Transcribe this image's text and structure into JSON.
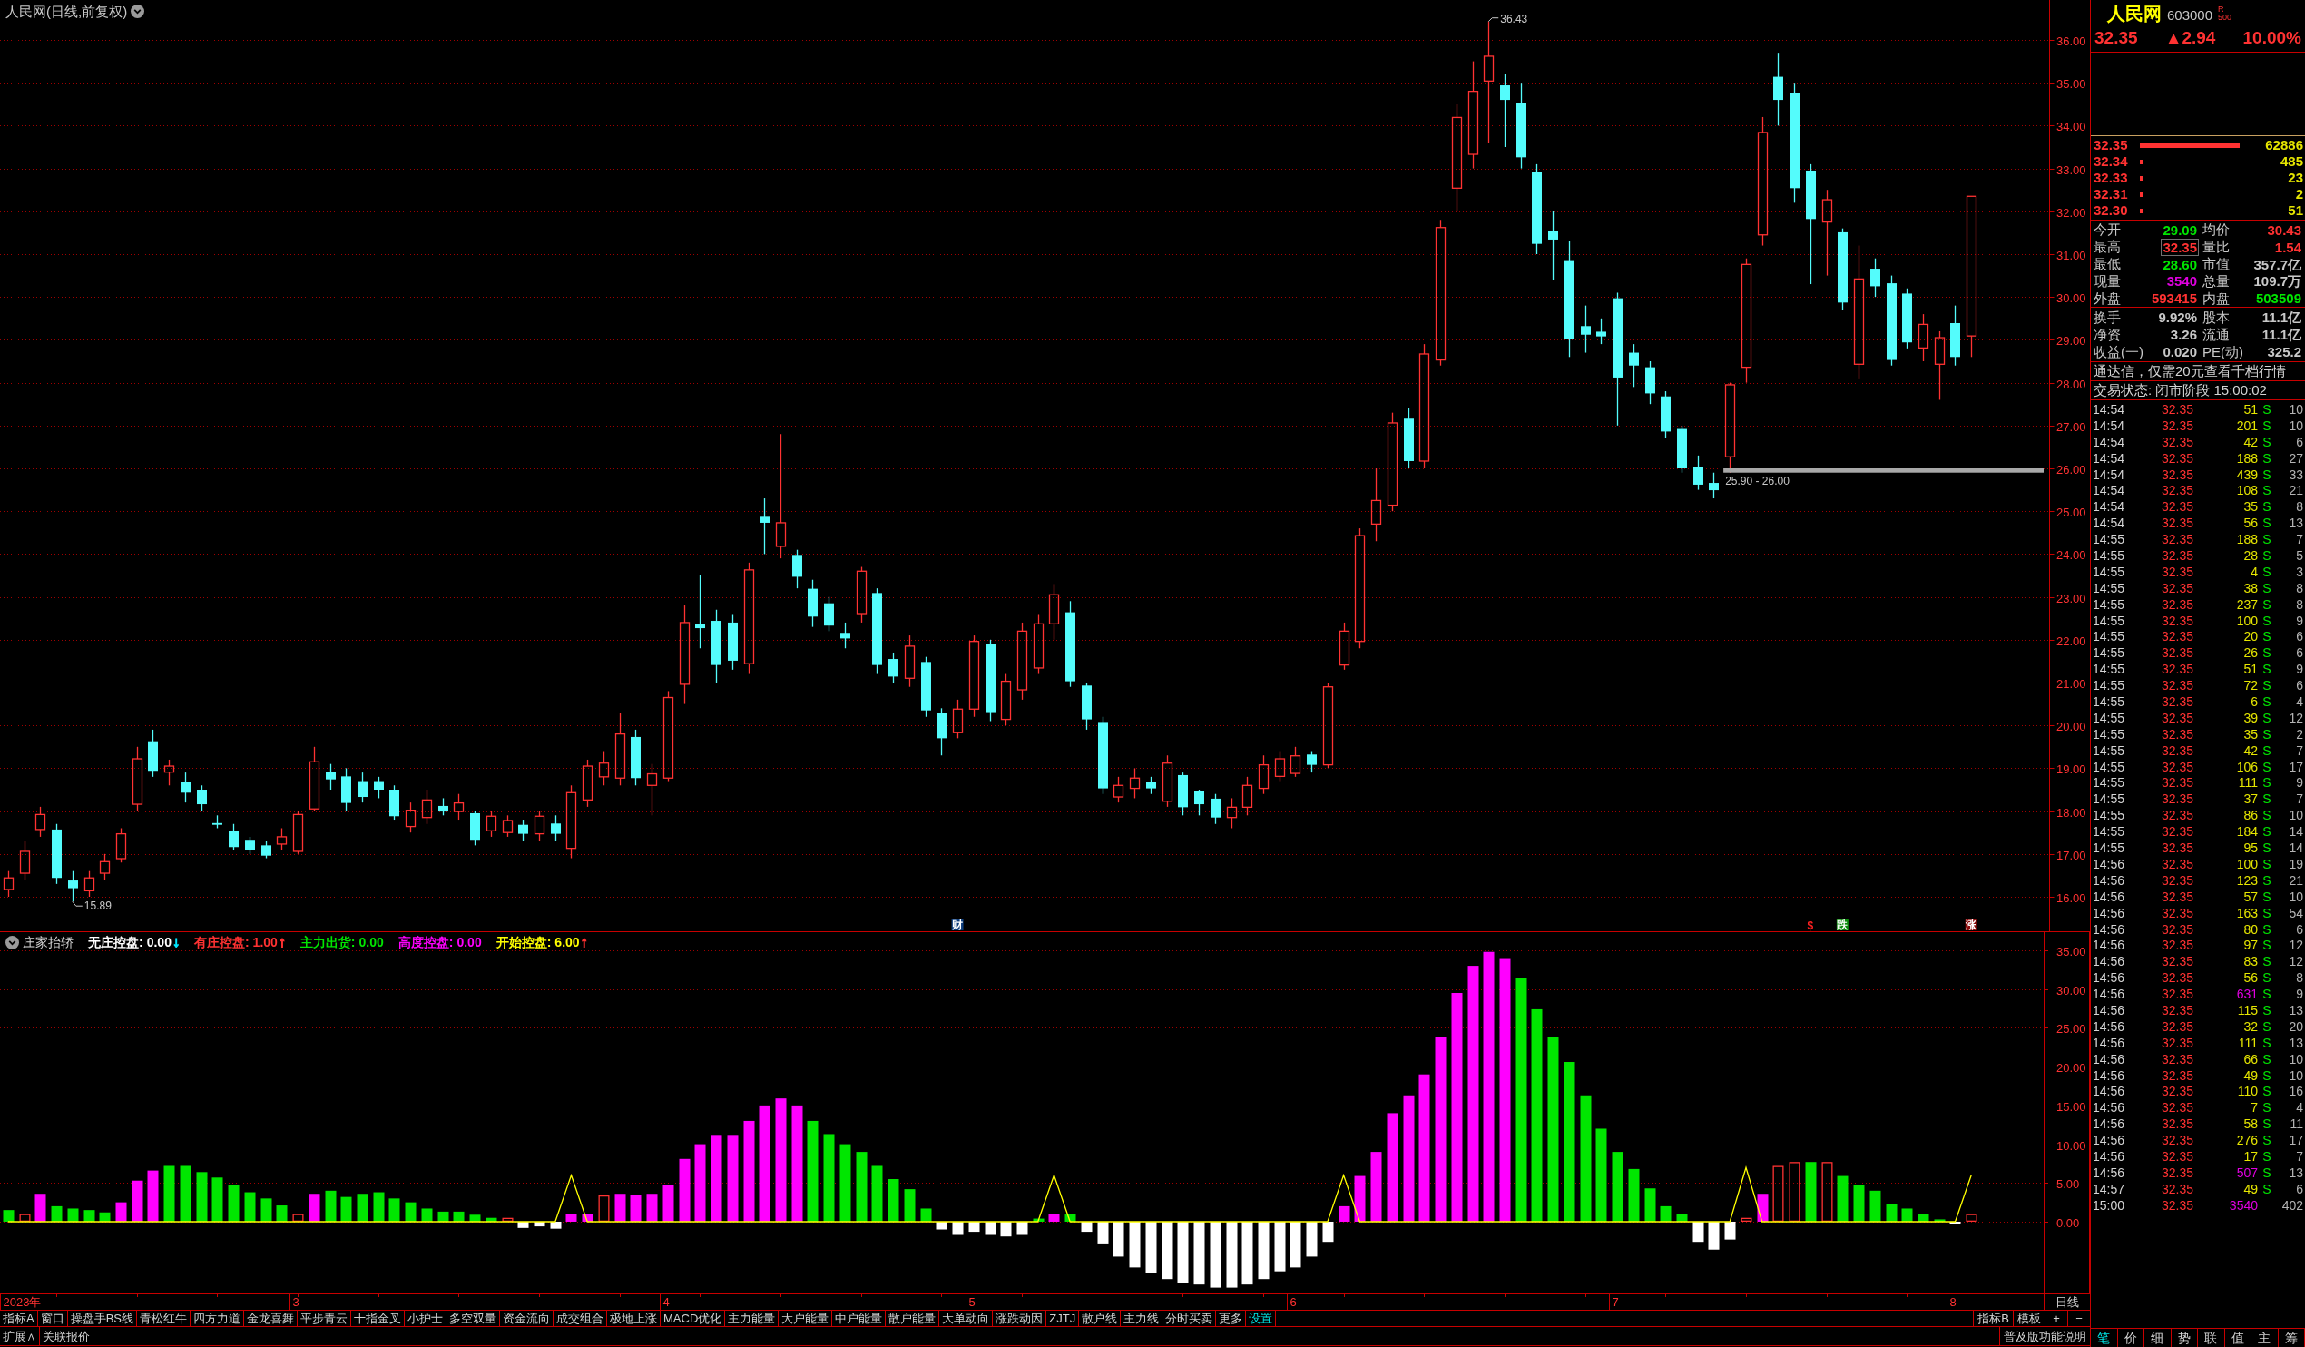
{
  "title": {
    "text": "人民网(日线,前复权)"
  },
  "main_chart": {
    "price_axis": [
      "36.00",
      "35.00",
      "34.00",
      "33.00",
      "32.00",
      "31.00",
      "30.00",
      "29.00",
      "28.00",
      "27.00",
      "26.00",
      "25.00",
      "24.00",
      "23.00",
      "22.00",
      "21.00",
      "20.00",
      "19.00",
      "18.00",
      "17.00",
      "16.00"
    ],
    "labels": {
      "peak": "36.43",
      "trough": "15.89",
      "range": "25.90 - 26.00"
    },
    "markers": [
      {
        "text": "财",
        "color": "#0c3c7c",
        "kind": "badge"
      },
      {
        "text": "$",
        "color": "#ff2020",
        "kind": "glyph"
      },
      {
        "text": "跌",
        "color": "#0a8a0a",
        "kind": "badge"
      },
      {
        "text": "涨",
        "color": "#8c0a0a",
        "kind": "badge"
      }
    ]
  },
  "indicator": {
    "name": "庄家抬轿",
    "chart_data": {
      "type": "bar",
      "grid": true,
      "stacked": true,
      "ylim": [
        -9.25,
        37.46
      ],
      "categories": [
        null,
        null,
        null,
        null,
        null,
        null,
        null,
        null,
        null,
        null,
        null,
        null,
        null,
        null,
        null,
        null,
        null,
        null,
        null,
        null,
        null,
        null,
        null,
        null,
        null,
        null,
        null,
        null,
        null,
        null,
        null,
        null,
        null,
        null,
        null,
        null,
        null,
        null,
        null,
        null,
        null,
        null,
        null,
        null,
        null,
        null,
        null,
        null,
        null,
        null,
        null,
        null,
        null,
        null,
        null,
        null,
        null,
        null,
        null,
        null,
        null,
        null,
        null,
        null,
        null,
        null,
        null,
        null,
        null,
        null,
        null,
        null,
        null,
        null,
        null,
        null,
        null,
        null,
        null,
        null,
        null,
        null,
        null,
        null,
        null,
        null,
        null,
        null,
        null,
        null,
        null,
        null,
        null,
        null,
        null,
        null,
        null,
        null,
        null,
        null,
        null,
        null,
        null,
        null,
        null,
        null,
        null,
        null,
        null,
        null,
        null,
        null,
        null,
        null,
        null,
        null,
        null,
        null,
        null,
        null,
        null,
        null,
        null,
        null,
        null,
        null,
        null
      ],
      "yticks": [
        {
          "value": 0,
          "label": "0.00"
        },
        {
          "value": 5,
          "label": "5.00"
        },
        {
          "value": 10,
          "label": "10.00"
        },
        {
          "value": 15,
          "label": "15.00"
        },
        {
          "value": 20,
          "label": "20.00"
        },
        {
          "value": 25,
          "label": "25.00"
        },
        {
          "value": 30,
          "label": "30.00"
        },
        {
          "value": 35,
          "label": "35.00"
        }
      ],
      "series": [
        {
          "name": "无庄控盘:",
          "color": "#ffffff",
          "values": [
            0,
            0,
            0,
            0,
            0,
            0,
            0,
            0,
            0,
            0,
            0,
            0,
            0,
            0,
            0,
            0,
            0,
            0,
            0,
            0,
            0,
            0,
            0,
            0,
            0,
            0,
            0,
            0,
            0,
            0,
            0,
            0,
            -0.8,
            -0.6,
            -0.9,
            0,
            0,
            0,
            0,
            0,
            0,
            0,
            0,
            0,
            0,
            0,
            0,
            0,
            0,
            0,
            0,
            0,
            0,
            0,
            0,
            0,
            0,
            0,
            -1,
            -1.7,
            -1.3,
            -1.7,
            -1.9,
            -1.7,
            0,
            0,
            0,
            -1.3,
            -2.8,
            -4.5,
            -5.9,
            -6.6,
            -7.4,
            -7.9,
            -8.1,
            -8.5,
            -8.5,
            -8.1,
            -7.4,
            -6.4,
            -5.9,
            -4.5,
            -2.6,
            0,
            0,
            0,
            0,
            0,
            0,
            0,
            0,
            0,
            0,
            0,
            0,
            0,
            0,
            0,
            0,
            0,
            0,
            0,
            0,
            0,
            0,
            -2.6,
            -3.6,
            -2.3,
            0,
            0,
            0,
            0,
            0,
            0,
            0,
            0,
            0,
            0,
            0,
            0,
            0,
            -0.3,
            0,
            null,
            null,
            null,
            null
          ]
        },
        {
          "name": "有庄控盘:",
          "color": "#ff3232",
          "values": [
            0,
            1,
            0,
            0,
            0,
            0,
            0,
            0,
            0,
            0,
            0,
            0,
            0,
            0,
            0,
            0,
            0,
            0,
            1,
            0,
            0,
            0,
            0,
            0,
            0,
            0,
            0,
            0,
            0,
            0,
            0,
            0.5,
            0,
            0,
            0,
            0,
            0,
            3.4,
            0,
            0,
            0,
            0,
            0,
            0,
            0,
            0,
            0,
            0,
            0,
            0,
            0,
            0,
            0,
            0,
            0,
            0,
            0,
            0,
            0,
            0,
            0,
            0,
            0,
            0,
            0,
            0,
            0,
            0,
            0,
            0,
            0,
            0,
            0,
            0,
            0,
            0,
            0,
            0,
            0,
            0,
            0,
            0,
            0,
            0,
            0,
            0,
            0,
            0,
            0,
            0,
            0,
            0,
            0,
            0,
            0,
            0,
            0,
            0,
            0,
            0,
            0,
            0,
            0,
            0,
            0,
            0,
            0,
            0,
            0.5,
            0,
            7.2,
            7.7,
            0,
            7.7,
            0,
            0,
            0,
            0,
            0,
            0,
            0,
            0,
            1,
            null,
            null,
            null,
            null
          ]
        },
        {
          "name": "主力出货:",
          "color": "#00e600",
          "values": [
            1.5,
            0,
            0,
            2,
            1.7,
            1.5,
            1.2,
            0,
            0,
            0,
            7.2,
            7.2,
            6.4,
            5.7,
            4.7,
            3.8,
            3,
            2.1,
            0,
            0,
            4,
            3.2,
            3.6,
            3.8,
            3,
            2.5,
            1.7,
            1.3,
            1.3,
            0.9,
            0.5,
            0,
            0,
            0,
            0,
            0,
            0,
            0,
            0,
            0,
            0,
            0,
            0,
            0,
            0,
            0,
            0,
            0,
            0,
            0,
            13,
            11.3,
            10,
            9,
            7.2,
            5.5,
            4.2,
            1.7,
            0,
            0,
            0,
            0,
            0,
            0,
            0.4,
            0,
            1,
            0,
            0,
            0,
            0,
            0,
            0,
            0,
            0,
            0,
            0,
            0,
            0,
            0,
            0,
            0,
            0,
            0,
            0,
            0,
            0,
            0,
            0,
            0,
            0,
            0,
            0,
            0,
            31.4,
            27.4,
            23.8,
            20.6,
            16.3,
            12,
            9,
            6.8,
            4.3,
            2,
            1,
            0,
            0,
            0,
            0,
            0,
            0,
            0,
            7.7,
            0,
            5.9,
            4.7,
            4,
            2.3,
            1.7,
            1,
            0.3,
            0,
            0,
            null,
            null,
            null,
            null
          ]
        },
        {
          "name": "高度控盘:",
          "color": "#ff00ff",
          "values": [
            0,
            0,
            3.6,
            0,
            0,
            0,
            0,
            2.5,
            5.3,
            6.6,
            0,
            0,
            0,
            0,
            0,
            0,
            0,
            0,
            0,
            3.6,
            0,
            0,
            0,
            0,
            0,
            0,
            0,
            0,
            0,
            0,
            0,
            0,
            0,
            0,
            0,
            1,
            1,
            0,
            3.6,
            3.4,
            3.6,
            4.7,
            8.1,
            10,
            11.2,
            11.2,
            13,
            15,
            15.9,
            15,
            0,
            0,
            0,
            0,
            0,
            0,
            0,
            0,
            0,
            0,
            0,
            0,
            0,
            0,
            0,
            1,
            0,
            0,
            0,
            0,
            0,
            0,
            0,
            0,
            0,
            0,
            0,
            0,
            0,
            0,
            0,
            0,
            0,
            2,
            5.9,
            9,
            14,
            16.3,
            19,
            23.8,
            29.5,
            33,
            34.8,
            34,
            0,
            0,
            0,
            0,
            0,
            0,
            0,
            0,
            0,
            0,
            0,
            0,
            0,
            0,
            0,
            3.6,
            0,
            0,
            0,
            0,
            0,
            0,
            0,
            0,
            0,
            0,
            0,
            0,
            0,
            null,
            null,
            null,
            null
          ]
        },
        {
          "name": "开始控盘:",
          "color": "#ffff00",
          "type": "line",
          "values": [
            0,
            0,
            0,
            0,
            0,
            0,
            0,
            0,
            0,
            0,
            0,
            0,
            0,
            0,
            0,
            0,
            0,
            0,
            0,
            0,
            0,
            0,
            0,
            0,
            0,
            0,
            0,
            0,
            0,
            0,
            0,
            0,
            0,
            0,
            0,
            6,
            0,
            0,
            0,
            0,
            0,
            0,
            0,
            0,
            0,
            0,
            0,
            0,
            0,
            0,
            0,
            0,
            0,
            0,
            0,
            0,
            0,
            0,
            0,
            0,
            0,
            0,
            0,
            0,
            0,
            6,
            0,
            0,
            0,
            0,
            0,
            0,
            0,
            0,
            0,
            0,
            0,
            0,
            0,
            0,
            0,
            0,
            0,
            6,
            0,
            0,
            0,
            0,
            0,
            0,
            0,
            0,
            0,
            0,
            0,
            0,
            0,
            0,
            0,
            0,
            0,
            0,
            0,
            0,
            0,
            0,
            0,
            0,
            7,
            0,
            0,
            0,
            0,
            0,
            0,
            0,
            0,
            0,
            0,
            0,
            0,
            0,
            6,
            null,
            null,
            null,
            null
          ]
        }
      ]
    },
    "legend": [
      {
        "value": "0.00",
        "arrow": {
          "text": "↓",
          "color": "#00e6ff"
        }
      },
      {
        "value": "1.00",
        "arrow": {
          "text": "↑",
          "color": "#ff3232"
        }
      },
      {
        "value": "0.00"
      },
      {
        "value": "0.00"
      },
      {
        "value": "6.00",
        "arrow": {
          "text": "↑",
          "color": "#ff3232"
        }
      }
    ]
  },
  "date_axis": {
    "labels": [
      "2023年",
      "3",
      "4",
      "5",
      "6",
      "7",
      "8"
    ],
    "period": "日线"
  },
  "tab_bar": {
    "tabs": [
      {
        "label": "指标A",
        "kind": "tab"
      },
      {
        "label": "窗口",
        "kind": "tab"
      },
      {
        "label": "操盘手BS线",
        "kind": "tab"
      },
      {
        "label": "青松红牛",
        "kind": "tab"
      },
      {
        "label": "四方力道",
        "kind": "tab"
      },
      {
        "label": "金龙喜舞",
        "kind": "tab"
      },
      {
        "label": "平步青云",
        "kind": "tab"
      },
      {
        "label": "十指金叉",
        "kind": "tab"
      },
      {
        "label": "小护士",
        "kind": "tab"
      },
      {
        "label": "多空双量",
        "kind": "tab"
      },
      {
        "label": "资金流向",
        "kind": "tab"
      },
      {
        "label": "成交组合",
        "kind": "tab"
      },
      {
        "label": "极地上涨",
        "kind": "tab"
      },
      {
        "label": "MACD优化",
        "kind": "tab"
      },
      {
        "label": "主力能量",
        "kind": "tab"
      },
      {
        "label": "大户能量",
        "kind": "tab"
      },
      {
        "label": "中户能量",
        "kind": "tab"
      },
      {
        "label": "散户能量",
        "kind": "tab"
      },
      {
        "label": "大单动向",
        "kind": "tab"
      },
      {
        "label": "涨跌动因",
        "kind": "tab"
      },
      {
        "label": "ZJTJ",
        "kind": "tab"
      },
      {
        "label": "散户线",
        "kind": "tab"
      },
      {
        "label": "主力线",
        "kind": "tab"
      },
      {
        "label": "分时买卖",
        "kind": "tab"
      },
      {
        "label": "更多",
        "kind": "tab"
      },
      {
        "label": "设置",
        "kind": "setting"
      }
    ],
    "tools": [
      "指标B",
      "模板",
      "+",
      "−"
    ]
  },
  "sub_bar": {
    "tabs": [
      "扩展∧",
      "关联报价"
    ],
    "help": "普及版功能说明"
  },
  "quote": {
    "name": "人民网",
    "code": "603000",
    "superscript": "R",
    "subscript": "500",
    "price": "32.35",
    "change": "▲2.94",
    "change_pct": "10.00%",
    "order_book": [
      {
        "price": "32.35",
        "volume": "62886"
      },
      {
        "price": "32.34",
        "volume": "485"
      },
      {
        "price": "32.33",
        "volume": "23"
      },
      {
        "price": "32.31",
        "volume": "2"
      },
      {
        "price": "32.30",
        "volume": "51"
      }
    ],
    "stats": [
      {
        "items": [
          {
            "label": "今开",
            "value": "29.09",
            "color": "#00e600",
            "boxed": false
          },
          {
            "label": "均价",
            "value": "30.43",
            "color": "#ff3232",
            "boxed": false
          },
          {
            "label": "最高",
            "value": "32.35",
            "color": "#ff3232",
            "boxed": true
          },
          {
            "label": "量比",
            "value": "1.54",
            "color": "#ff3232",
            "boxed": false
          },
          {
            "label": "最低",
            "value": "28.60",
            "color": "#00e600",
            "boxed": false
          },
          {
            "label": "市值",
            "value": "357.7亿",
            "color": "#c8c8c8",
            "boxed": false
          },
          {
            "label": "现量",
            "value": "3540",
            "color": "#e000e0",
            "boxed": false
          },
          {
            "label": "总量",
            "value": "109.7万",
            "color": "#c8c8c8",
            "boxed": false
          },
          {
            "label": "外盘",
            "value": "593415",
            "color": "#ff3232",
            "boxed": false
          },
          {
            "label": "内盘",
            "value": "503509",
            "color": "#00e600",
            "boxed": false
          }
        ]
      },
      {
        "items": [
          {
            "label": "换手",
            "value": "9.92%",
            "color": "#c8c8c8",
            "boxed": false
          },
          {
            "label": "股本",
            "value": "11.1亿",
            "color": "#c8c8c8",
            "boxed": false
          },
          {
            "label": "净资",
            "value": "3.26",
            "color": "#c8c8c8",
            "boxed": false
          },
          {
            "label": "流通",
            "value": "11.1亿",
            "color": "#c8c8c8",
            "boxed": false
          },
          {
            "label": "收益(一)",
            "value": "0.020",
            "color": "#c8c8c8",
            "boxed": false
          },
          {
            "label": "PE(动)",
            "value": "325.2",
            "color": "#c8c8c8",
            "boxed": false
          }
        ]
      }
    ],
    "notice": "通达信，仅需20元查看千档行情",
    "status": "交易状态: 闭市阶段 15:00:02",
    "trades": [
      {
        "time": "14:54",
        "price": "32.35",
        "volume": "51",
        "large": false,
        "side": "S",
        "count": "10"
      },
      {
        "time": "14:54",
        "price": "32.35",
        "volume": "201",
        "large": false,
        "side": "S",
        "count": "10"
      },
      {
        "time": "14:54",
        "price": "32.35",
        "volume": "42",
        "large": false,
        "side": "S",
        "count": "6"
      },
      {
        "time": "14:54",
        "price": "32.35",
        "volume": "188",
        "large": false,
        "side": "S",
        "count": "27"
      },
      {
        "time": "14:54",
        "price": "32.35",
        "volume": "439",
        "large": false,
        "side": "S",
        "count": "33"
      },
      {
        "time": "14:54",
        "price": "32.35",
        "volume": "108",
        "large": false,
        "side": "S",
        "count": "21"
      },
      {
        "time": "14:54",
        "price": "32.35",
        "volume": "35",
        "large": false,
        "side": "S",
        "count": "8"
      },
      {
        "time": "14:54",
        "price": "32.35",
        "volume": "56",
        "large": false,
        "side": "S",
        "count": "13"
      },
      {
        "time": "14:55",
        "price": "32.35",
        "volume": "188",
        "large": false,
        "side": "S",
        "count": "7"
      },
      {
        "time": "14:55",
        "price": "32.35",
        "volume": "28",
        "large": false,
        "side": "S",
        "count": "5"
      },
      {
        "time": "14:55",
        "price": "32.35",
        "volume": "4",
        "large": false,
        "side": "S",
        "count": "3"
      },
      {
        "time": "14:55",
        "price": "32.35",
        "volume": "38",
        "large": false,
        "side": "S",
        "count": "8"
      },
      {
        "time": "14:55",
        "price": "32.35",
        "volume": "237",
        "large": false,
        "side": "S",
        "count": "8"
      },
      {
        "time": "14:55",
        "price": "32.35",
        "volume": "100",
        "large": false,
        "side": "S",
        "count": "9"
      },
      {
        "time": "14:55",
        "price": "32.35",
        "volume": "20",
        "large": false,
        "side": "S",
        "count": "6"
      },
      {
        "time": "14:55",
        "price": "32.35",
        "volume": "26",
        "large": false,
        "side": "S",
        "count": "6"
      },
      {
        "time": "14:55",
        "price": "32.35",
        "volume": "51",
        "large": false,
        "side": "S",
        "count": "9"
      },
      {
        "time": "14:55",
        "price": "32.35",
        "volume": "72",
        "large": false,
        "side": "S",
        "count": "6"
      },
      {
        "time": "14:55",
        "price": "32.35",
        "volume": "6",
        "large": false,
        "side": "S",
        "count": "4"
      },
      {
        "time": "14:55",
        "price": "32.35",
        "volume": "39",
        "large": false,
        "side": "S",
        "count": "12"
      },
      {
        "time": "14:55",
        "price": "32.35",
        "volume": "35",
        "large": false,
        "side": "S",
        "count": "2"
      },
      {
        "time": "14:55",
        "price": "32.35",
        "volume": "42",
        "large": false,
        "side": "S",
        "count": "7"
      },
      {
        "time": "14:55",
        "price": "32.35",
        "volume": "106",
        "large": false,
        "side": "S",
        "count": "17"
      },
      {
        "time": "14:55",
        "price": "32.35",
        "volume": "111",
        "large": false,
        "side": "S",
        "count": "9"
      },
      {
        "time": "14:55",
        "price": "32.35",
        "volume": "37",
        "large": false,
        "side": "S",
        "count": "7"
      },
      {
        "time": "14:55",
        "price": "32.35",
        "volume": "86",
        "large": false,
        "side": "S",
        "count": "10"
      },
      {
        "time": "14:55",
        "price": "32.35",
        "volume": "184",
        "large": false,
        "side": "S",
        "count": "14"
      },
      {
        "time": "14:55",
        "price": "32.35",
        "volume": "95",
        "large": false,
        "side": "S",
        "count": "14"
      },
      {
        "time": "14:56",
        "price": "32.35",
        "volume": "100",
        "large": false,
        "side": "S",
        "count": "19"
      },
      {
        "time": "14:56",
        "price": "32.35",
        "volume": "123",
        "large": false,
        "side": "S",
        "count": "21"
      },
      {
        "time": "14:56",
        "price": "32.35",
        "volume": "57",
        "large": false,
        "side": "S",
        "count": "10"
      },
      {
        "time": "14:56",
        "price": "32.35",
        "volume": "163",
        "large": false,
        "side": "S",
        "count": "54"
      },
      {
        "time": "14:56",
        "price": "32.35",
        "volume": "80",
        "large": false,
        "side": "S",
        "count": "6"
      },
      {
        "time": "14:56",
        "price": "32.35",
        "volume": "97",
        "large": false,
        "side": "S",
        "count": "12"
      },
      {
        "time": "14:56",
        "price": "32.35",
        "volume": "83",
        "large": false,
        "side": "S",
        "count": "12"
      },
      {
        "time": "14:56",
        "price": "32.35",
        "volume": "56",
        "large": false,
        "side": "S",
        "count": "8"
      },
      {
        "time": "14:56",
        "price": "32.35",
        "volume": "631",
        "large": true,
        "side": "S",
        "count": "9"
      },
      {
        "time": "14:56",
        "price": "32.35",
        "volume": "115",
        "large": false,
        "side": "S",
        "count": "13"
      },
      {
        "time": "14:56",
        "price": "32.35",
        "volume": "32",
        "large": false,
        "side": "S",
        "count": "20"
      },
      {
        "time": "14:56",
        "price": "32.35",
        "volume": "111",
        "large": false,
        "side": "S",
        "count": "13"
      },
      {
        "time": "14:56",
        "price": "32.35",
        "volume": "66",
        "large": false,
        "side": "S",
        "count": "10"
      },
      {
        "time": "14:56",
        "price": "32.35",
        "volume": "49",
        "large": false,
        "side": "S",
        "count": "10"
      },
      {
        "time": "14:56",
        "price": "32.35",
        "volume": "110",
        "large": false,
        "side": "S",
        "count": "16"
      },
      {
        "time": "14:56",
        "price": "32.35",
        "volume": "7",
        "large": false,
        "side": "S",
        "count": "4"
      },
      {
        "time": "14:56",
        "price": "32.35",
        "volume": "58",
        "large": false,
        "side": "S",
        "count": "11"
      },
      {
        "time": "14:56",
        "price": "32.35",
        "volume": "276",
        "large": false,
        "side": "S",
        "count": "17"
      },
      {
        "time": "14:56",
        "price": "32.35",
        "volume": "17",
        "large": false,
        "side": "S",
        "count": "7"
      },
      {
        "time": "14:56",
        "price": "32.35",
        "volume": "507",
        "large": true,
        "side": "S",
        "count": "13"
      },
      {
        "time": "14:57",
        "price": "32.35",
        "volume": "49",
        "large": false,
        "side": "S",
        "count": "6"
      },
      {
        "time": "15:00",
        "price": "32.35",
        "volume": "3540",
        "large": true,
        "count": "402"
      }
    ],
    "tabs": [
      {
        "label": "笔",
        "selected": true
      },
      {
        "label": "价",
        "selected": false
      },
      {
        "label": "细",
        "selected": false
      },
      {
        "label": "势",
        "selected": false
      },
      {
        "label": "联",
        "selected": false
      },
      {
        "label": "值",
        "selected": false
      },
      {
        "label": "主",
        "selected": false
      },
      {
        "label": "筹",
        "selected": false
      }
    ]
  }
}
